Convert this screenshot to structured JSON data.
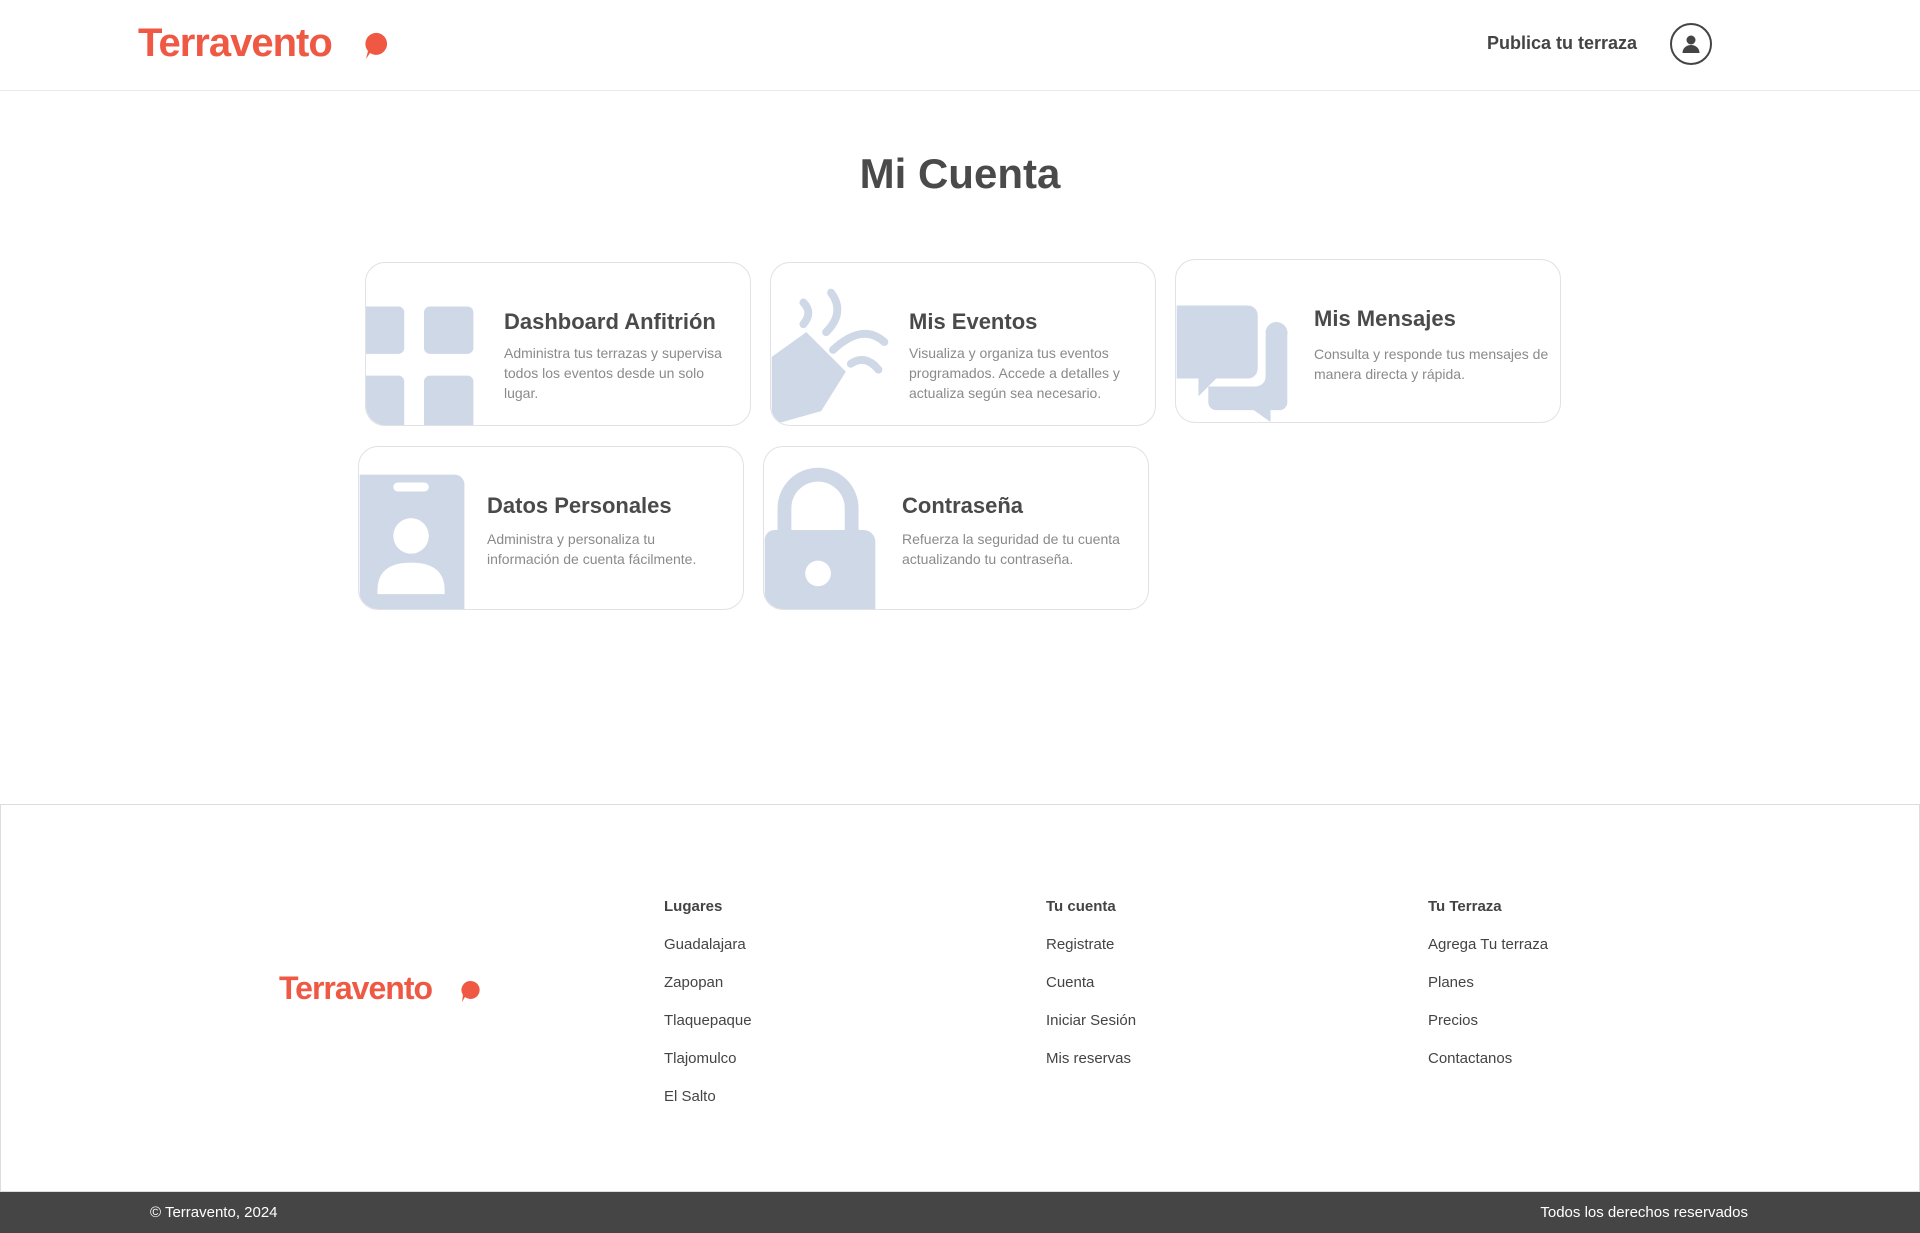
{
  "brand": {
    "name": "Terravento",
    "color": "#ef5944"
  },
  "header": {
    "publica_label": "Publica tu terraza",
    "account_icon": "user-circle-icon"
  },
  "page_title": "Mi Cuenta",
  "cards": [
    {
      "title": "Dashboard Anfitrión",
      "description": "Administra tus terrazas y supervisa todos los eventos desde un solo lugar.",
      "icon": "grid-icon"
    },
    {
      "title": "Mis Eventos",
      "description": "Visualiza y organiza tus eventos programados. Accede a detalles y actualiza según sea necesario.",
      "icon": "party-popper-icon"
    },
    {
      "title": "Mis Mensajes",
      "description": "Consulta y responde tus mensajes de manera directa y rápida.",
      "icon": "chat-bubbles-icon"
    },
    {
      "title": "Datos Personales",
      "description": "Administra y personaliza tu información de cuenta fácilmente.",
      "icon": "id-badge-icon"
    },
    {
      "title": "Contraseña",
      "description": "Refuerza la seguridad de tu cuenta actualizando tu contraseña.",
      "icon": "lock-icon"
    }
  ],
  "footer": {
    "columns": [
      {
        "heading": "Lugares",
        "links": [
          "Guadalajara",
          "Zapopan",
          "Tlaquepaque",
          "Tlajomulco",
          "El Salto"
        ]
      },
      {
        "heading": "Tu cuenta",
        "links": [
          "Registrate",
          "Cuenta",
          "Iniciar Sesión",
          "Mis reservas"
        ]
      },
      {
        "heading": "Tu Terraza",
        "links": [
          "Agrega Tu terraza",
          "Planes",
          "Precios",
          "Contactanos"
        ]
      }
    ],
    "copyright": "© Terravento, 2024",
    "rights": "Todos los derechos reservados"
  },
  "colors": {
    "illustration": "#cfd8e6",
    "text_dark": "#4a4a4a",
    "text_muted": "#8a8a8a",
    "bottom_bar": "#454545"
  }
}
